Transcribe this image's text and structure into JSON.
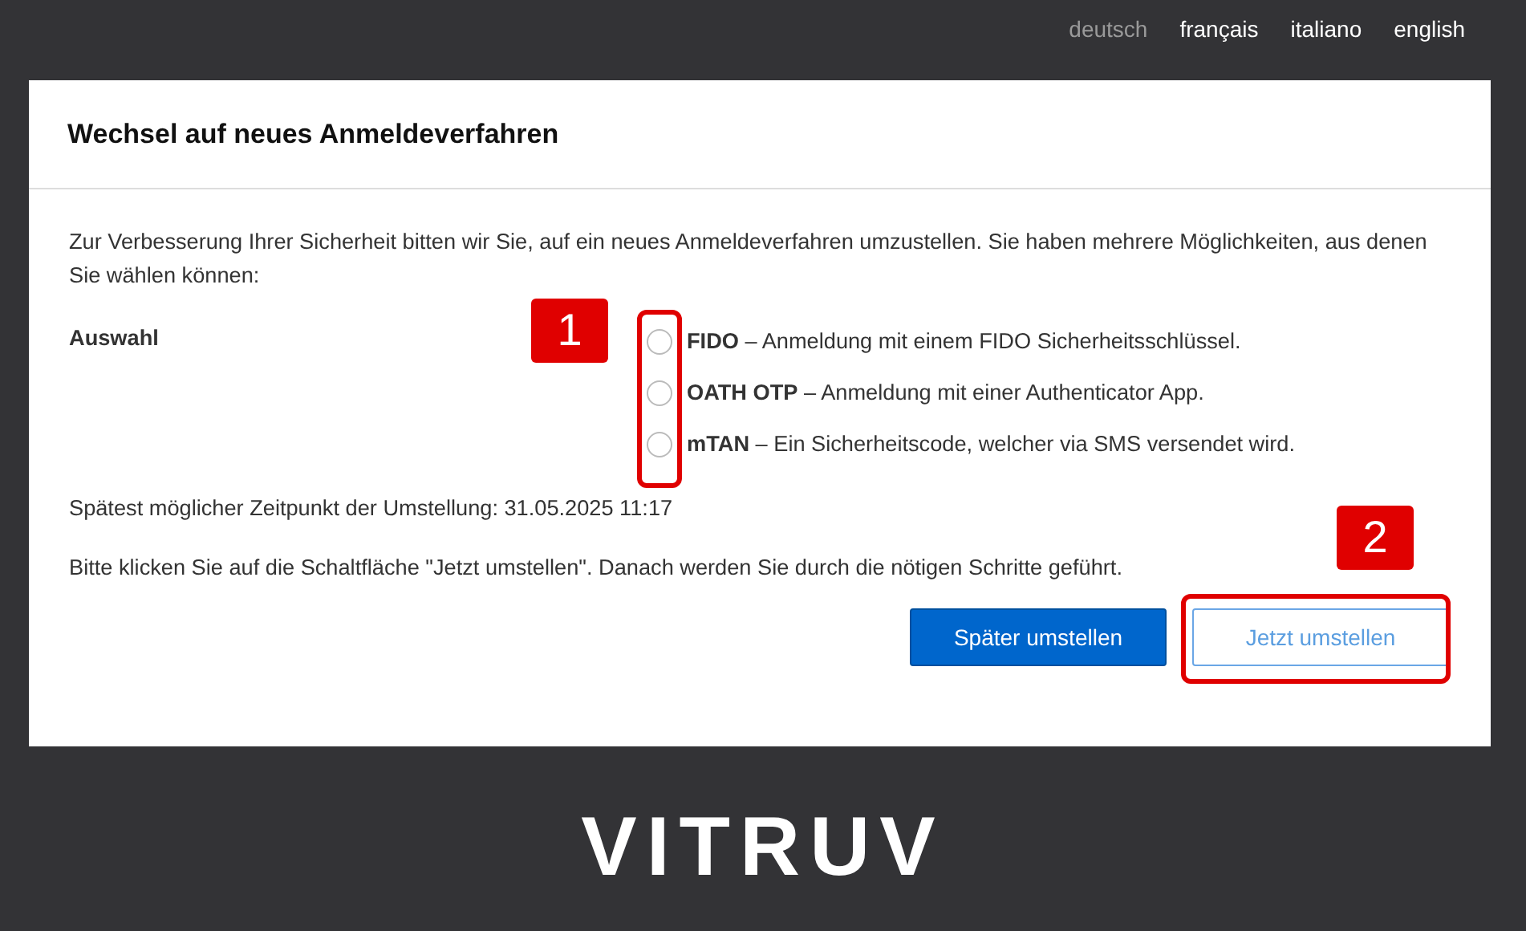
{
  "languages": [
    {
      "label": "deutsch",
      "selected": true
    },
    {
      "label": "français",
      "selected": false
    },
    {
      "label": "italiano",
      "selected": false
    },
    {
      "label": "english",
      "selected": false
    }
  ],
  "card": {
    "title": "Wechsel auf neues Anmeldeverfahren",
    "intro": "Zur Verbesserung Ihrer Sicherheit bitten wir Sie, auf ein neues Anmeldeverfahren umzustellen. Sie haben mehrere Möglichkeiten, aus denen Sie wählen können:",
    "choice": {
      "label": "Auswahl",
      "callout": "1",
      "options": [
        {
          "text": "**FIDO** – Anmeldung mit einem FIDO Sicherheitsschlüssel.",
          "selected": false
        },
        {
          "text": "**OATH OTP** – Anmeldung mit einer Authenticator App.",
          "selected": false
        },
        {
          "text": "**mTAN** – Ein Sicherheitscode, welcher via SMS versendet wird.",
          "selected": false
        }
      ]
    },
    "deadline": "Spätest möglicher Zeitpunkt der Umstellung: 31.05.2025 11:17",
    "instruction": "Bitte klicken Sie auf die Schaltfläche \"Jetzt umstellen\". Danach werden Sie durch die nötigen Schritte geführt.",
    "buttons": [
      {
        "label": "Später umstellen",
        "kind": "primary"
      },
      {
        "label": "Jetzt umstellen",
        "kind": "secondary",
        "callout": "2"
      }
    ]
  },
  "logo": "VITRUV"
}
